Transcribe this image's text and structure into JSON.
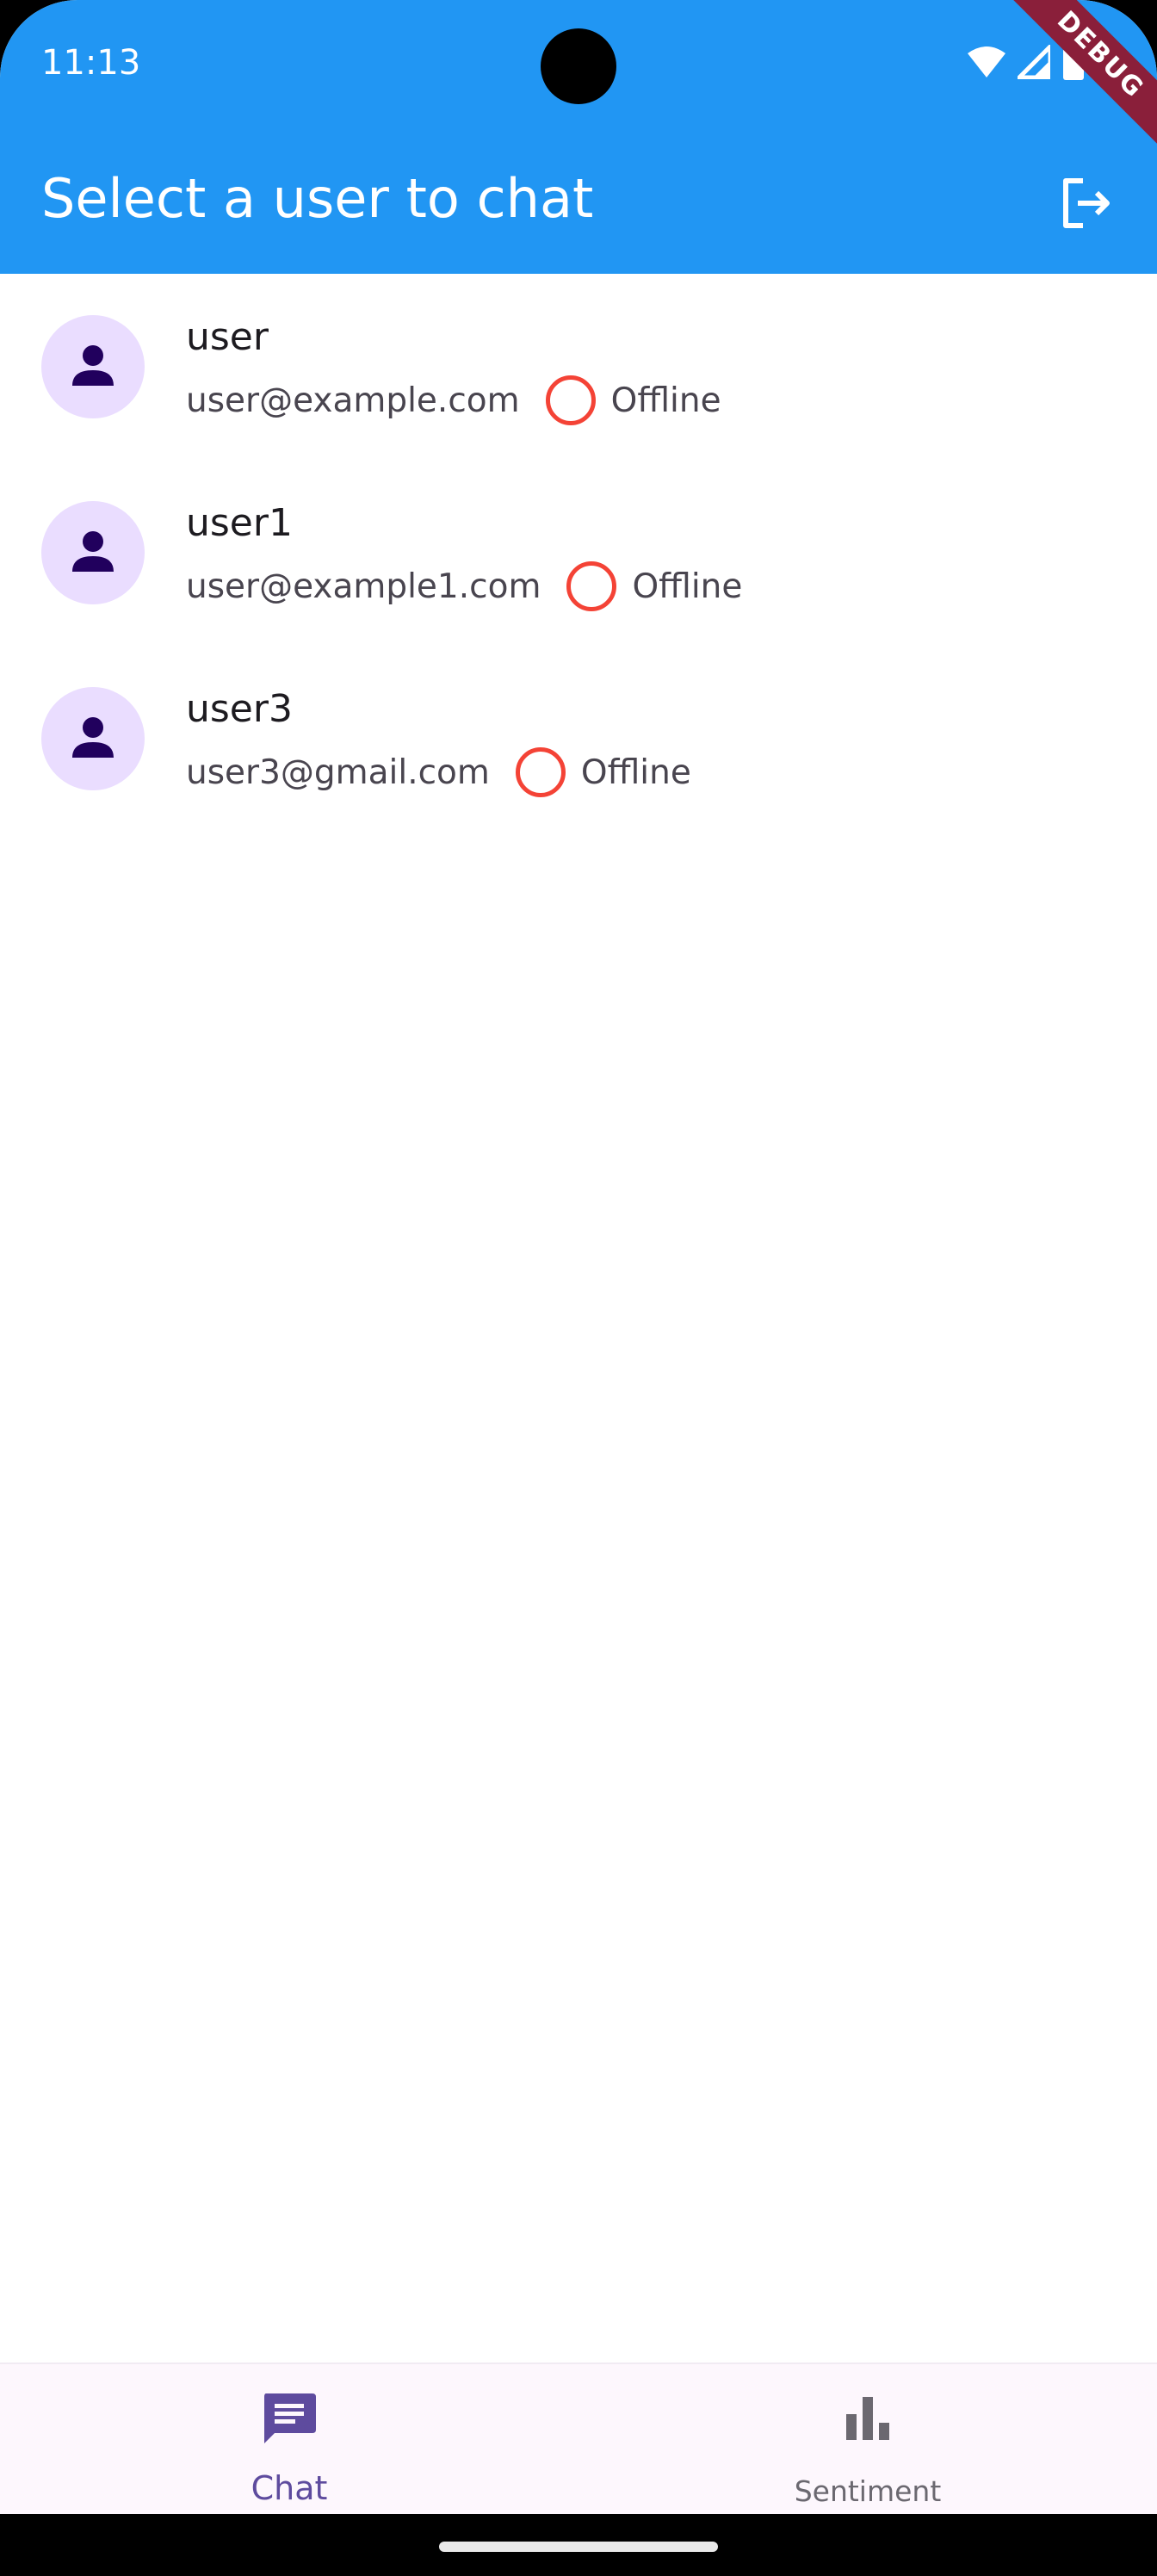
{
  "status_bar": {
    "time": "11:13"
  },
  "debug_banner": "DEBUG",
  "app_bar": {
    "title": "Select a user to chat"
  },
  "users": [
    {
      "name": "user",
      "email": "user@example.com",
      "status": "Offline"
    },
    {
      "name": "user1",
      "email": "user@example1.com",
      "status": "Offline"
    },
    {
      "name": "user3",
      "email": "user3@gmail.com",
      "status": "Offline"
    }
  ],
  "bottom_nav": {
    "items": [
      {
        "label": "Chat",
        "icon": "chat-icon",
        "selected": true
      },
      {
        "label": "Sentiment",
        "icon": "bar-chart-icon",
        "selected": false
      }
    ]
  },
  "colors": {
    "app_bar": "#2196F3",
    "avatar_bg": "#EADDFF",
    "avatar_icon": "#21005D",
    "offline_ring": "#f44336",
    "nav_selected": "#5e4b9e"
  }
}
